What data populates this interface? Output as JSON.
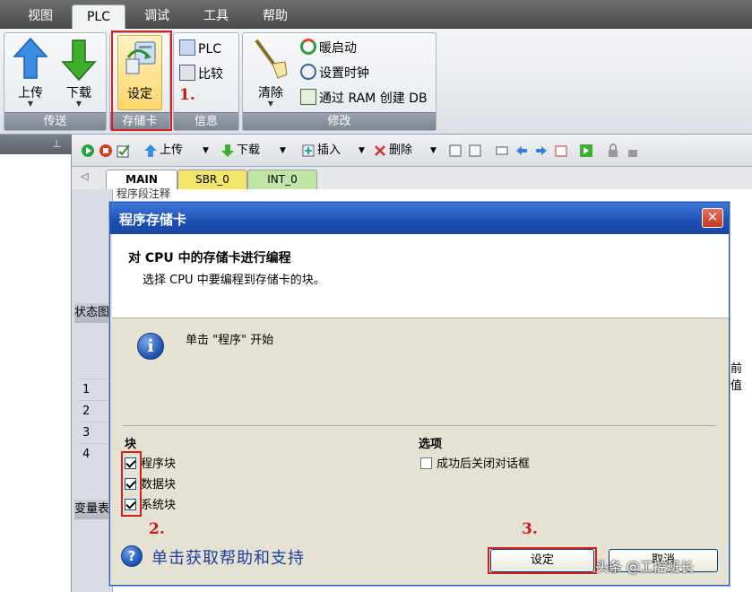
{
  "menubar": {
    "items": [
      "视图",
      "PLC",
      "调试",
      "工具",
      "帮助"
    ],
    "active": "PLC"
  },
  "ribbon": {
    "transfer": {
      "upload": "上传",
      "download": "下载",
      "group": "传送"
    },
    "memcard": {
      "set": "设定",
      "group": "存储卡"
    },
    "info": {
      "plc": "PLC",
      "compare": "比较",
      "group": "信息"
    },
    "modify": {
      "clear": "清除",
      "warm_start": "暖启动",
      "set_clock": "设置时钟",
      "create_db": "通过 RAM 创建 DB",
      "group": "修改"
    }
  },
  "toolbar": {
    "upload": "上传",
    "download": "下载",
    "insert": "插入",
    "delete": "删除"
  },
  "tabs": [
    "MAIN",
    "SBR_0",
    "INT_0"
  ],
  "editor": {
    "comment": "程序段注释"
  },
  "panes": {
    "status": "状态图",
    "vars": "变量表",
    "prev_value": "前值"
  },
  "rows": [
    "1",
    "2",
    "3",
    "4"
  ],
  "dialog": {
    "title": "程序存储卡",
    "heading": "对 CPU 中的存储卡进行编程",
    "subheading": "选择 CPU 中要编程到存储卡的块。",
    "info": "单击 \"程序\" 开始",
    "blocks_label": "块",
    "options_label": "选项",
    "blocks": [
      {
        "label": "程序块",
        "checked": true
      },
      {
        "label": "数据块",
        "checked": true
      },
      {
        "label": "系统块",
        "checked": true
      }
    ],
    "option_close": "成功后关闭对话框",
    "help": "单击获取帮助和支持",
    "ok": "设定",
    "cancel": "取消"
  },
  "steps": {
    "s1": "1.",
    "s2": "2.",
    "s3": "3."
  },
  "watermark": "头条 @工控班长",
  "colors": {
    "highlight_red": "#d21f1f",
    "title_blue": "#1d4fb2",
    "help_blue": "#1f3f9b"
  }
}
